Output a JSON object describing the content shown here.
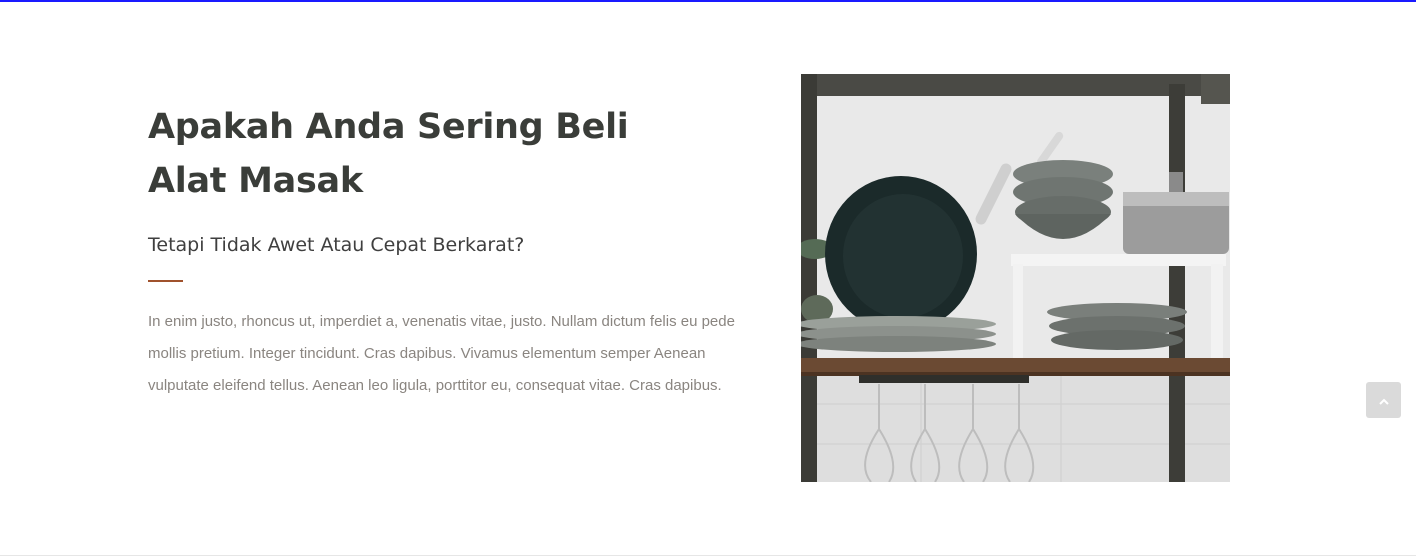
{
  "section": {
    "heading": "Apakah Anda Sering Beli Alat Masak",
    "subheading": "Tetapi Tidak Awet Atau Cepat Berkarat?",
    "body": "In enim justo, rhoncus ut, imperdiet a, venenatis vitae, justo. Nullam dictum felis eu pede mollis pretium. Integer tincidunt. Cras dapibus. Vivamus elementum semper Aenean vulputate eleifend tellus. Aenean leo ligula, porttitor eu, consequat vitae. Cras dapibus."
  },
  "colors": {
    "heading": "#3a3d39",
    "accent_divider": "#a0522d",
    "body_text": "#8a8580",
    "top_border": "#1a1aff"
  },
  "icons": {
    "scroll_top": "chevron-up-icon"
  }
}
